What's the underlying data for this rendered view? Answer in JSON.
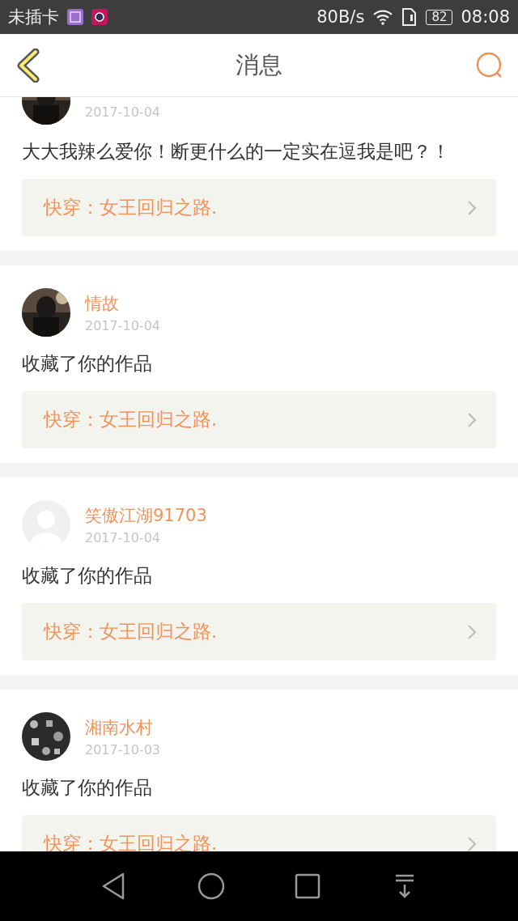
{
  "status_bar": {
    "carrier": "未插卡",
    "speed": "80B/s",
    "battery": "82",
    "time": "08:08"
  },
  "header": {
    "title": "消息"
  },
  "messages": [
    {
      "date": "2017-10-04",
      "text": "大大我辣么爱你！断更什么的一定实在逗我是吧？！",
      "book": "快穿：女王回归之路."
    },
    {
      "name": "情故",
      "date": "2017-10-04",
      "text": "收藏了你的作品",
      "book": "快穿：女王回归之路."
    },
    {
      "avatar": {
        "kind": "placeholder"
      },
      "name": "笑傲江湖91703",
      "date": "2017-10-04",
      "text": "收藏了你的作品",
      "book": "快穿：女王回归之路."
    },
    {
      "avatar": {
        "kind": "pattern"
      },
      "name": "湘南水村",
      "date": "2017-10-03",
      "text": "收藏了你的作品",
      "book": "快穿：女王回归之路."
    }
  ]
}
